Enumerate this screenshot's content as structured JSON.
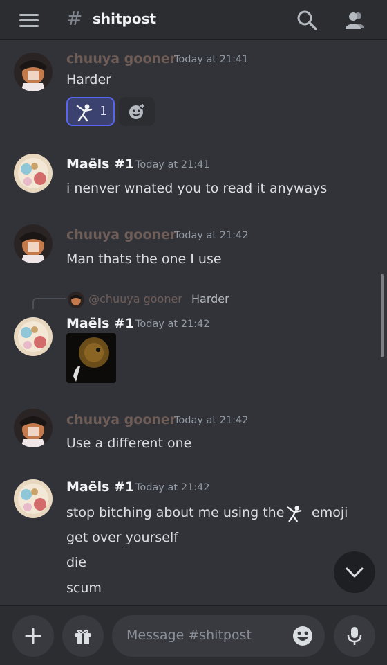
{
  "channel": {
    "hash": "#",
    "name": "shitpost"
  },
  "icons": {
    "menu": "hamburger-menu-icon",
    "search": "search-icon",
    "members": "members-icon",
    "add": "plus-icon",
    "gift": "gift-icon",
    "emoji": "emoji-icon",
    "mic": "microphone-icon",
    "jump": "chevron-down-icon",
    "add_reaction": "add-reaction-icon"
  },
  "colors": {
    "background": "#313338",
    "chuuya_name": "#6f5d58",
    "reaction_accent": "#5865f2"
  },
  "messages": [
    {
      "author": "chuuya gooner",
      "timestamp": "Today at 21:41",
      "lines": [
        "Harder"
      ],
      "reaction": {
        "emoji": "fencer",
        "count": "1"
      }
    },
    {
      "author": "Maëls #1",
      "timestamp": "Today at 21:41",
      "lines": [
        "i nenver wnated you to read it anyways"
      ]
    },
    {
      "author": "chuuya gooner",
      "timestamp": "Today at 21:42",
      "lines": [
        "Man thats the one I use"
      ]
    },
    {
      "author": "Maëls #1",
      "timestamp": "Today at 21:42",
      "reply": {
        "name": "@chuuya gooner",
        "text": "Harder"
      },
      "attachment": "image"
    },
    {
      "author": "chuuya gooner",
      "timestamp": "Today at 21:42",
      "lines": [
        "Use a different one"
      ]
    },
    {
      "author": "Maëls #1",
      "timestamp": "Today at 21:42",
      "line1_before": "stop bitching about me using the",
      "line1_after": "emoji",
      "lines": [
        "get over yourself",
        "die",
        "scum"
      ]
    }
  ],
  "composer": {
    "placeholder": "Message #shitpost"
  }
}
